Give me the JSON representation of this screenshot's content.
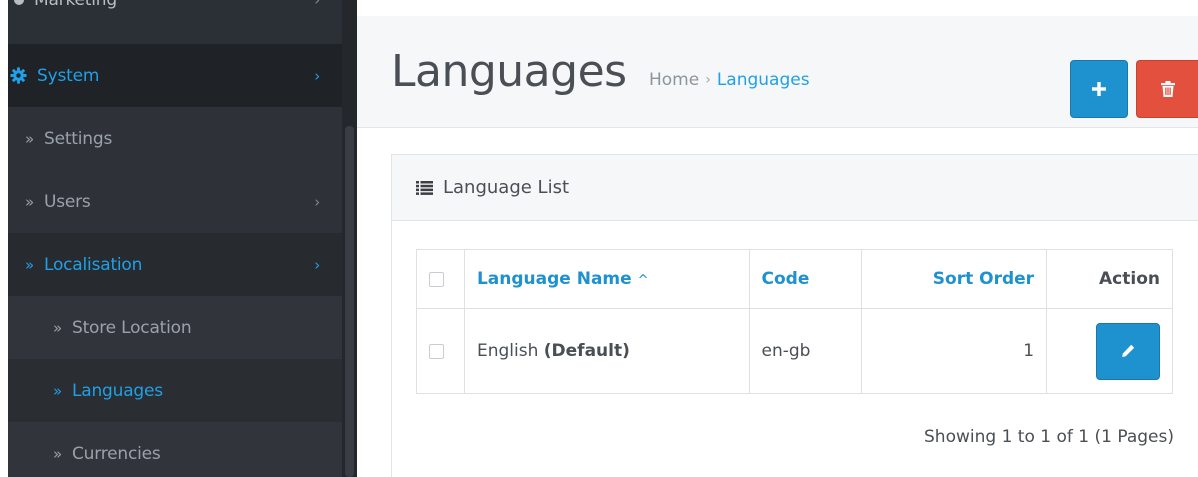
{
  "sidebar": {
    "items": [
      {
        "label": "Marketing"
      },
      {
        "label": "System"
      },
      {
        "label": "Settings"
      },
      {
        "label": "Users"
      },
      {
        "label": "Localisation"
      },
      {
        "label": "Store Location"
      },
      {
        "label": "Languages"
      },
      {
        "label": "Currencies"
      }
    ],
    "icons": {
      "system": "cog-icon",
      "submenu_marker": "double-chevron-right-icon",
      "expand": "chevron-right-icon"
    }
  },
  "header": {
    "title": "Languages",
    "breadcrumb": {
      "home": "Home",
      "separator": "›",
      "current": "Languages"
    },
    "buttons": {
      "add": "plus-icon",
      "delete": "trash-icon"
    }
  },
  "panel": {
    "title": "Language List",
    "icon": "list-icon",
    "table": {
      "headers": {
        "name": "Language Name",
        "code": "Code",
        "sort_order": "Sort Order",
        "action": "Action"
      },
      "sort_indicator": "^",
      "rows": [
        {
          "name": "English",
          "default_label": "(Default)",
          "code": "en-gb",
          "sort_order": "1"
        }
      ]
    },
    "pagination": "Showing 1 to 1 of 1 (1 Pages)"
  },
  "colors": {
    "accent": "#1e91cf",
    "danger": "#e3503e",
    "sidebar_bg": "#2b2f36",
    "sidebar_active_text": "#20a0e6"
  }
}
